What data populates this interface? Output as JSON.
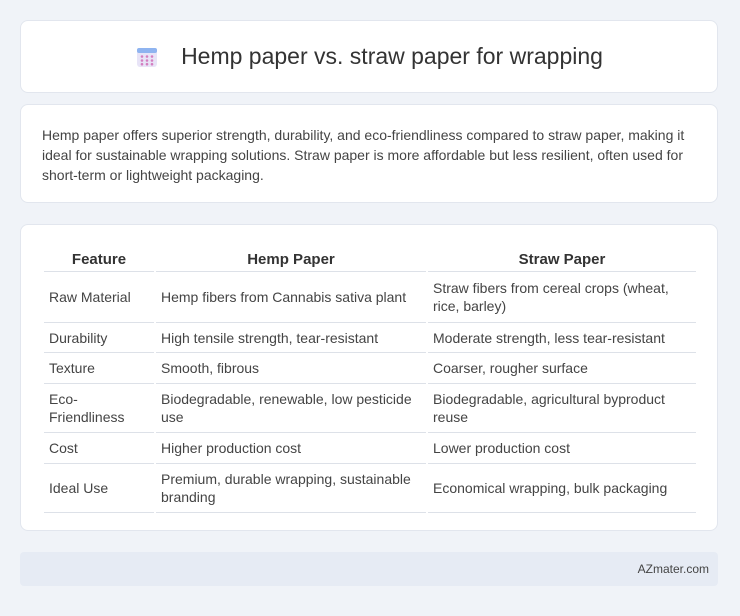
{
  "header": {
    "title": "Hemp paper vs. straw paper for wrapping",
    "icon": "calendar-grid-icon"
  },
  "intro": {
    "text": "Hemp paper offers superior strength, durability, and eco-friendliness compared to straw paper, making it ideal for sustainable wrapping solutions. Straw paper is more affordable but less resilient, often used for short-term or lightweight packaging."
  },
  "table": {
    "headers": [
      "Feature",
      "Hemp Paper",
      "Straw Paper"
    ],
    "rows": [
      [
        "Raw Material",
        "Hemp fibers from Cannabis sativa plant",
        "Straw fibers from cereal crops (wheat, rice, barley)"
      ],
      [
        "Durability",
        "High tensile strength, tear-resistant",
        "Moderate strength, less tear-resistant"
      ],
      [
        "Texture",
        "Smooth, fibrous",
        "Coarser, rougher surface"
      ],
      [
        "Eco-Friendliness",
        "Biodegradable, renewable, low pesticide use",
        "Biodegradable, agricultural byproduct reuse"
      ],
      [
        "Cost",
        "Higher production cost",
        "Lower production cost"
      ],
      [
        "Ideal Use",
        "Premium, durable wrapping, sustainable branding",
        "Economical wrapping, bulk packaging"
      ]
    ]
  },
  "footer": {
    "brand": "AZmater.com"
  }
}
